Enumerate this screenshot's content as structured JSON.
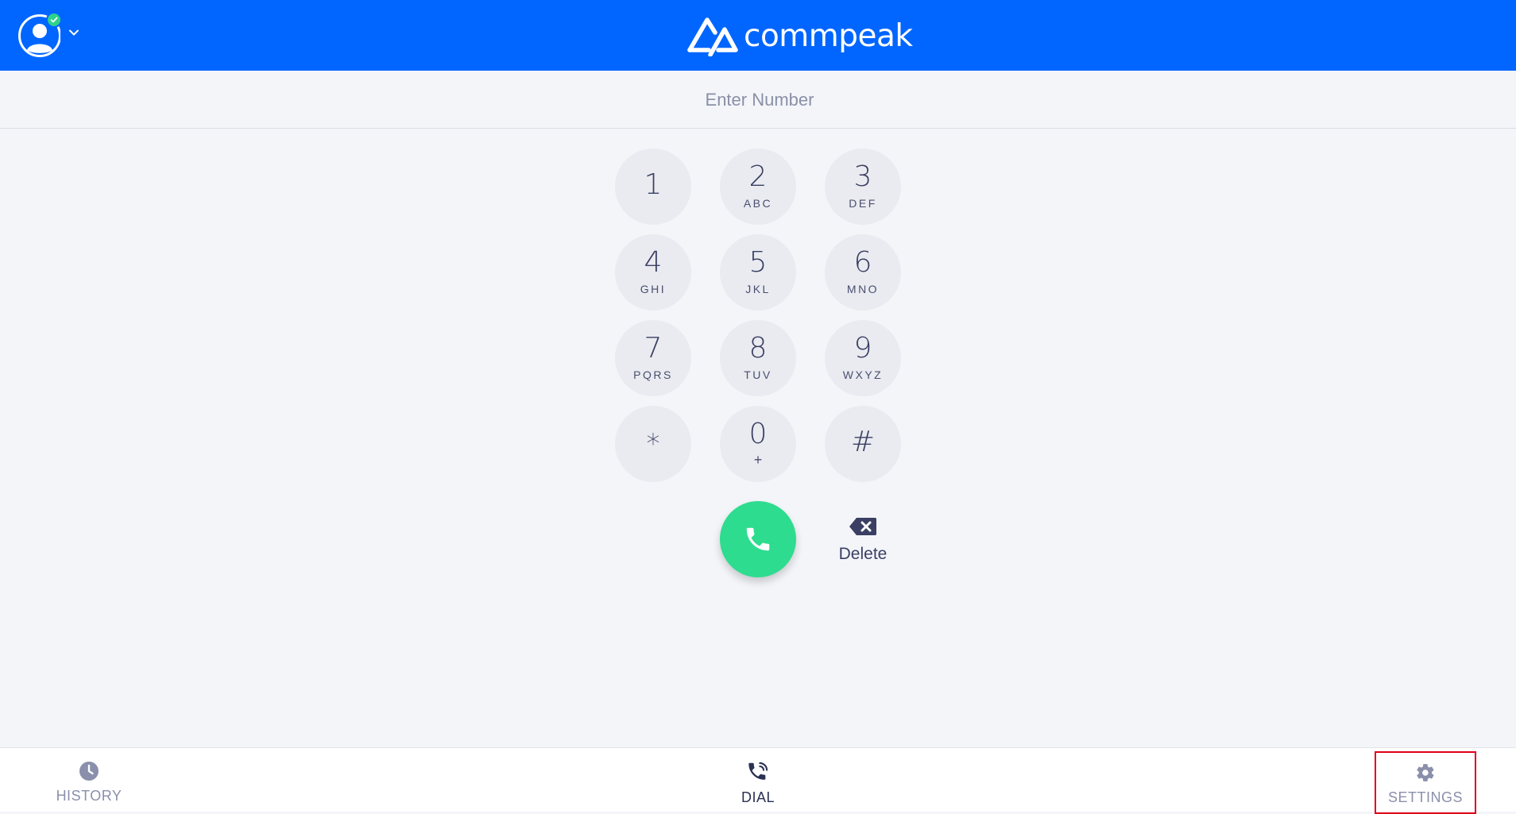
{
  "header": {
    "brand_name": "commpeak",
    "status": "online",
    "colors": {
      "bar": "#0066ff",
      "status": "#2ed38a"
    }
  },
  "dialer": {
    "number_placeholder": "Enter Number",
    "number_value": "",
    "keys": [
      {
        "digit": "1",
        "letters": ""
      },
      {
        "digit": "2",
        "letters": "ABC"
      },
      {
        "digit": "3",
        "letters": "DEF"
      },
      {
        "digit": "4",
        "letters": "GHI"
      },
      {
        "digit": "5",
        "letters": "JKL"
      },
      {
        "digit": "6",
        "letters": "MNO"
      },
      {
        "digit": "7",
        "letters": "PQRS"
      },
      {
        "digit": "8",
        "letters": "TUV"
      },
      {
        "digit": "9",
        "letters": "WXYZ"
      },
      {
        "digit": "*",
        "letters": ""
      },
      {
        "digit": "0",
        "letters": "+"
      },
      {
        "digit": "#",
        "letters": ""
      }
    ],
    "call_icon": "phone-icon",
    "call_color": "#2edc8f",
    "delete_label": "Delete",
    "delete_icon": "backspace-icon"
  },
  "bottom_nav": {
    "items": [
      {
        "label": "HISTORY",
        "icon": "clock-icon",
        "active": false
      },
      {
        "label": "DIAL",
        "icon": "phone-call-icon",
        "active": true
      },
      {
        "label": "SETTINGS",
        "icon": "gear-icon",
        "active": false,
        "highlighted": true
      }
    ]
  }
}
